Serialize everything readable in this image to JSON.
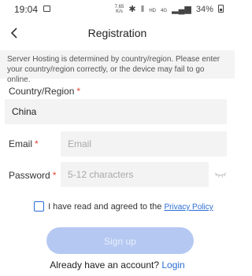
{
  "status_bar": {
    "time": "19:04",
    "speed_value": "7.65",
    "speed_unit": "K/s",
    "network_label": "HD",
    "signal_label": "4G",
    "battery": "34%"
  },
  "header": {
    "title": "Registration"
  },
  "notice": "Server Hosting is determined by country/region. Please enter your country/region correctly, or the device may fail to go online.",
  "country": {
    "label": "Country/Region",
    "required_mark": "*",
    "value": "China"
  },
  "email": {
    "label": "Email",
    "required_mark": "*",
    "placeholder": "Email"
  },
  "password": {
    "label": "Password",
    "required_mark": "*",
    "placeholder": "5-12 characters"
  },
  "agreement": {
    "text": "I have read and agreed to the",
    "link": "Privacy Policy"
  },
  "signup_button": "Sign up",
  "login": {
    "prompt": "Already have an account?",
    "link": "Login"
  },
  "colors": {
    "accent": "#2b6cd4",
    "button_disabled": "#b5c8f2",
    "required": "#e2443b",
    "field_bg": "#f3f3f3"
  },
  "icons": [
    "image-icon",
    "mute-icon",
    "vibrate-icon",
    "signal-icon",
    "battery-icon",
    "back-arrow-icon",
    "eye-closed-icon"
  ]
}
